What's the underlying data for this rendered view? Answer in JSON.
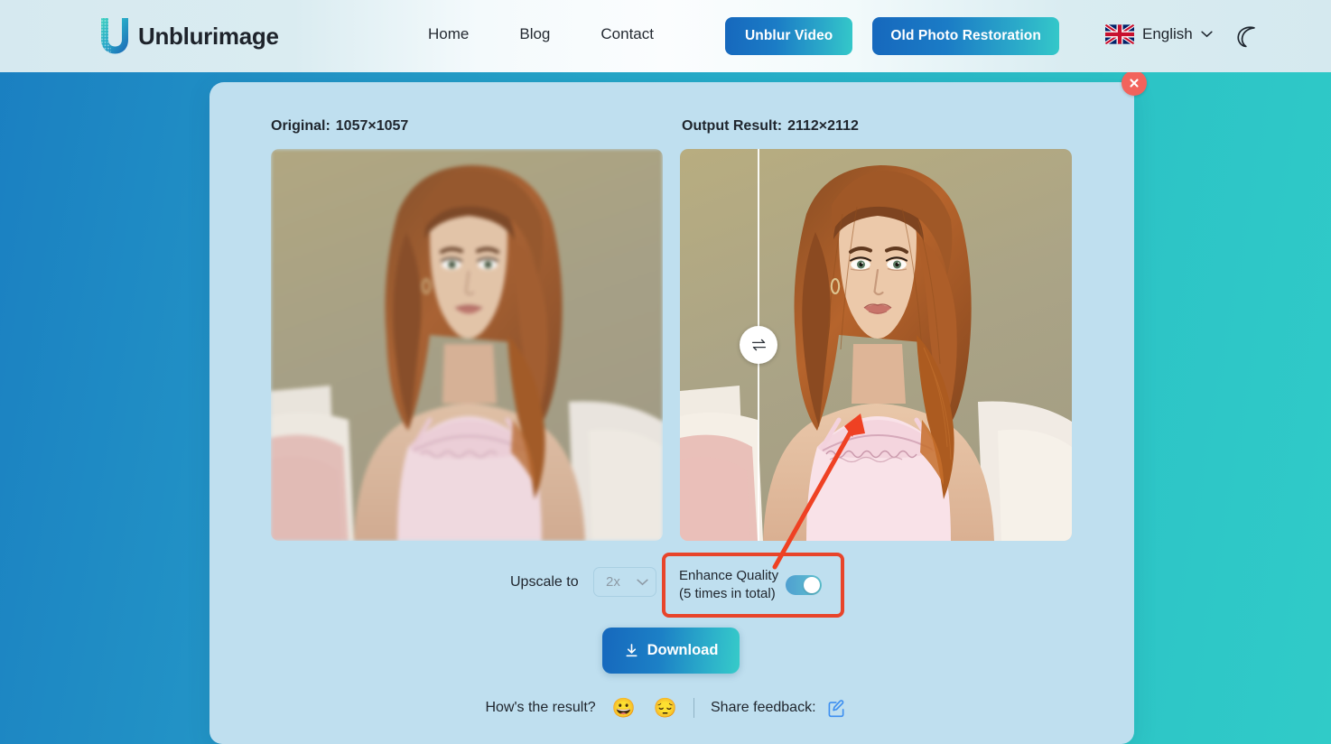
{
  "header": {
    "logo_text": "Unblurimage",
    "logo_icon": "unblurimage-u-logo",
    "nav": [
      {
        "label": "Home",
        "name": "nav-home"
      },
      {
        "label": "Blog",
        "name": "nav-blog"
      },
      {
        "label": "Contact",
        "name": "nav-contact"
      }
    ],
    "cta_primary": "Unblur Video",
    "cta_secondary": "Old Photo Restoration",
    "language": "English",
    "language_flag_icon": "uk-flag-icon",
    "chevron_icon": "chevron-down-icon",
    "theme_toggle_icon": "moon-icon",
    "accent_gradient_start": "#1668bd",
    "accent_gradient_end": "#36cbc9"
  },
  "panel": {
    "close_icon": "close-x-icon",
    "original": {
      "label": "Original:",
      "dimensions": "1057×1057"
    },
    "output": {
      "label": "Output Result:",
      "dimensions": "2112×2112"
    },
    "compare_handle_icon": "swap-horizontal-icon"
  },
  "controls": {
    "upscale_label": "Upscale to",
    "upscale_value": "2x",
    "upscale_chevron_icon": "chevron-down-icon",
    "enhance_title": "Enhance Quality",
    "enhance_subtitle": "(5 times in total)",
    "enhance_toggle_state": "on",
    "highlight_color": "#e8442a"
  },
  "download": {
    "label": "Download",
    "icon": "download-icon"
  },
  "feedback": {
    "question": "How's the result?",
    "emoji_happy": "😀",
    "emoji_sad": "😔",
    "share_label": "Share feedback:",
    "share_icon": "edit-square-icon"
  },
  "annotation": {
    "arrow_color": "#ef4123",
    "arrow_icon": "red-pointer-arrow"
  }
}
